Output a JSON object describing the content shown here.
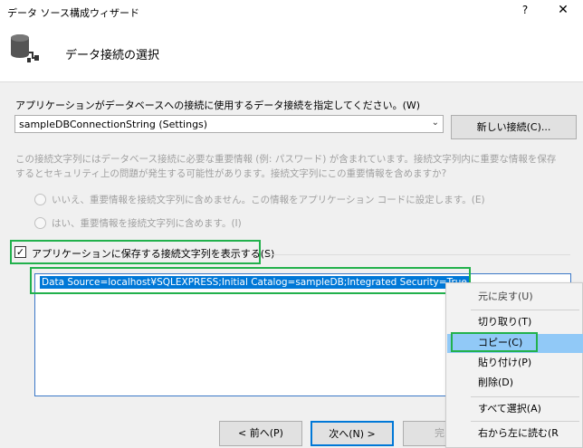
{
  "window": {
    "title": "データ ソース構成ウィザード",
    "help": "?",
    "close": "✕"
  },
  "header": {
    "title": "データ接続の選択",
    "icon": "database-connection-icon"
  },
  "connection": {
    "prompt": "アプリケーションがデータベースへの接続に使用するデータ接続を指定してください。(W)",
    "selected": "sampleDBConnectionString (Settings)",
    "new_button": "新しい接続(C)..."
  },
  "sensitive": {
    "description_line1": "この接続文字列にはデータベース接続に必要な重要情報 (例: パスワード) が含まれています。接続文字列内に重要な情報を保存",
    "description_line2": "するとセキュリティ上の問題が発生する可能性があります。接続文字列にこの重要情報を含めますか?",
    "option_no": "いいえ、重要情報を接続文字列に含めません。この情報をアプリケーション コードに設定します。(E)",
    "option_yes": "はい、重要情報を接続文字列に含めます。(I)"
  },
  "show_string": {
    "label": "アプリケーションに保存する接続文字列を表示する(S)",
    "checked": true,
    "check_glyph": "✓"
  },
  "connection_string": "Data Source=localhost¥SQLEXPRESS;Initial Catalog=sampleDB;Integrated Security=True",
  "buttons": {
    "back": "< 前へ(P)",
    "next": "次へ(N) >",
    "finish": "完了"
  },
  "context_menu": {
    "undo": "元に戻す(U)",
    "cut": "切り取り(T)",
    "copy": "コピー(C)",
    "paste": "貼り付け(P)",
    "delete": "削除(D)",
    "select_all": "すべて選択(A)",
    "rtl": "右から左に読む(R"
  },
  "colors": {
    "highlight_outline": "#22b14c",
    "selection": "#0078d7",
    "menu_hover": "#91c9f7"
  }
}
